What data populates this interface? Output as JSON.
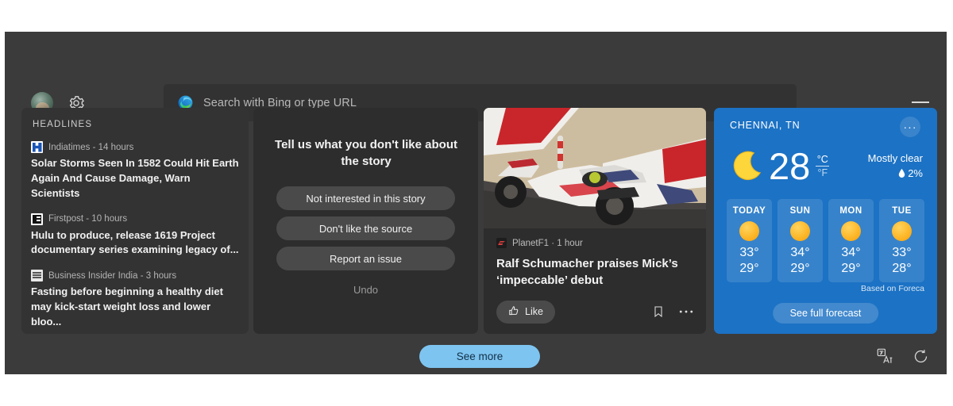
{
  "toolbar": {
    "avatar_name": "user-avatar",
    "settings_label": "Settings",
    "omnibox_placeholder": "Search with Bing or type URL",
    "omnibox_value": "",
    "minimize_label": "Minimize"
  },
  "headlines": {
    "title": "HEADLINES",
    "items": [
      {
        "source": "Indiatimes",
        "time": "14 hours",
        "meta": "Indiatimes - 14 hours",
        "headline": "Solar Storms Seen In 1582 Could Hit Earth Again And Cause Damage, Warn Scientists",
        "favicon": "indiatimes-favicon"
      },
      {
        "source": "Firstpost",
        "time": "10 hours",
        "meta": "Firstpost - 10 hours",
        "headline": "Hulu to produce, release 1619 Project documentary series examining legacy of...",
        "favicon": "firstpost-favicon"
      },
      {
        "source": "Business Insider India",
        "time": "3 hours",
        "meta": "Business Insider India - 3 hours",
        "headline": "Fasting before beginning a healthy diet may kick-start weight loss and lower bloo...",
        "favicon": "business-insider-favicon"
      }
    ]
  },
  "feedback": {
    "title": "Tell us what you don't like about the story",
    "options": [
      "Not interested in this story",
      "Don't like the source",
      "Report an issue"
    ],
    "undo_label": "Undo"
  },
  "story": {
    "source": "PlanetF1",
    "time": "1 hour",
    "meta": "PlanetF1 · 1 hour",
    "headline": "Ralf Schumacher praises Mick’s ‘impeccable’ debut",
    "like_label": "Like",
    "save_label": "Save",
    "more_label": "More options",
    "image_alt": "Formula 1 Haas car on desert circuit with red and white kerbs"
  },
  "weather": {
    "city": "CHENNAI, TN",
    "more_label": "···",
    "temperature": "28",
    "unit_active": "°C",
    "unit_inactive": "°F",
    "condition": "Mostly clear",
    "precipitation": "2%",
    "precip_icon": "💧",
    "now_icon": "moon-icon",
    "forecast": [
      {
        "day": "TODAY",
        "icon": "sun-icon",
        "high": "33°",
        "low": "29°"
      },
      {
        "day": "SUN",
        "icon": "sun-icon",
        "high": "34°",
        "low": "29°"
      },
      {
        "day": "MON",
        "icon": "sun-icon",
        "high": "34°",
        "low": "29°"
      },
      {
        "day": "TUE",
        "icon": "sun-icon",
        "high": "33°",
        "low": "28°"
      }
    ],
    "credit": "Based on Foreca",
    "full_forecast_label": "See full forecast",
    "accent_color": "#1c72c4"
  },
  "footer": {
    "see_more_label": "See more",
    "translate_label": "Translate",
    "refresh_label": "Refresh",
    "see_more_color": "#7ec4f0"
  }
}
